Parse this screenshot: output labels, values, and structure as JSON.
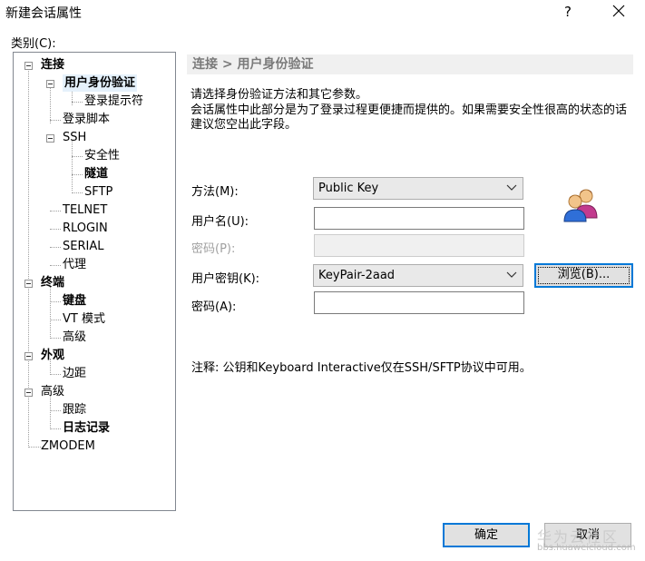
{
  "window": {
    "title": "新建会话属性",
    "help_label": "?",
    "close_icon": "close-icon"
  },
  "category_label": "类别(C):",
  "tree": {
    "nodes": [
      {
        "label": "连接"
      },
      {
        "label": "用户身份验证"
      },
      {
        "label": "登录提示符"
      },
      {
        "label": "登录脚本"
      },
      {
        "label": "SSH"
      },
      {
        "label": "安全性"
      },
      {
        "label": "隧道"
      },
      {
        "label": "SFTP"
      },
      {
        "label": "TELNET"
      },
      {
        "label": "RLOGIN"
      },
      {
        "label": "SERIAL"
      },
      {
        "label": "代理"
      },
      {
        "label": "终端"
      },
      {
        "label": "键盘"
      },
      {
        "label": "VT 模式"
      },
      {
        "label": "高级"
      },
      {
        "label": "外观"
      },
      {
        "label": "边距"
      },
      {
        "label": "高级"
      },
      {
        "label": "跟踪"
      },
      {
        "label": "日志记录"
      },
      {
        "label": "ZMODEM"
      }
    ]
  },
  "panel": {
    "header": "连接 > 用户身份验证",
    "description_line1": "请选择身份验证方法和其它参数。",
    "description_line2": "会话属性中此部分是为了登录过程更便捷而提供的。如果需要安全性很高的状态的话建议您空出此字段。"
  },
  "form": {
    "method_label": "方法(M):",
    "method_value": "Public Key",
    "username_label": "用户名(U):",
    "username_value": "",
    "password_label": "密码(P):",
    "password_value": "",
    "userkey_label": "用户密钥(K):",
    "userkey_value": "KeyPair-2aad",
    "browse_label": "浏览(B)...",
    "passphrase_label": "密码(A):",
    "passphrase_value": ""
  },
  "note": "注释: 公钥和Keyboard Interactive仅在SSH/SFTP协议中可用。",
  "buttons": {
    "ok": "确定",
    "cancel": "取消"
  },
  "watermark": {
    "text": "华为云社区",
    "url": "bbs.huaweicloud.com"
  },
  "colors": {
    "accent": "#0078d7",
    "header_bg": "#f0f0f0",
    "header_text": "#7a7a7a",
    "selection_bg": "#e5f1fb"
  }
}
